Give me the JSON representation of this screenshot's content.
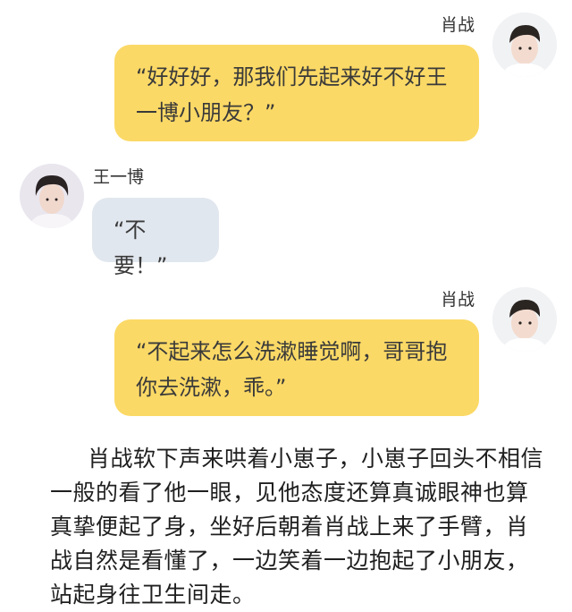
{
  "messages": [
    {
      "sender": "肖战",
      "text": "“好好好，那我们先起来好不好王一博小朋友？”"
    },
    {
      "sender": "王一博",
      "text": "“不要！”"
    },
    {
      "sender": "肖战",
      "text": "“不起来怎么洗漱睡觉啊，哥哥抱你去洗漱，乖。”"
    }
  ],
  "narration": "肖战软下声来哄着小崽子，小崽子回头不相信一般的看了他一眼，见他态度还算真诚眼神也算真挚便起了身，坐好后朝着肖战上来了手臂，肖战自然是看懂了，一边笑着一边抱起了小朋友，站起身往卫生间走。",
  "colors": {
    "bubble_right": "#fbd966",
    "bubble_left": "#e1e7ee"
  }
}
